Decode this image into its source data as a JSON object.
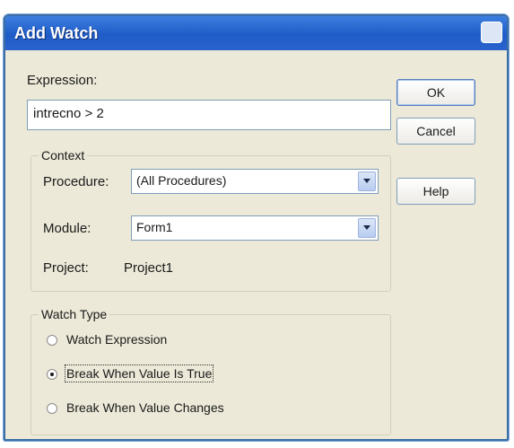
{
  "dialog": {
    "title": "Add Watch",
    "expression_label": "Expression:",
    "expression_value": "intrecno > 2",
    "context": {
      "legend": "Context",
      "procedure_label": "Procedure:",
      "procedure_value": "(All Procedures)",
      "module_label": "Module:",
      "module_value": "Form1",
      "project_label": "Project:",
      "project_value": "Project1"
    },
    "watch_type": {
      "legend": "Watch Type",
      "options": [
        {
          "label": "Watch Expression",
          "selected": false
        },
        {
          "label": "Break When Value Is True",
          "selected": true
        },
        {
          "label": "Break When Value Changes",
          "selected": false
        }
      ]
    },
    "buttons": {
      "ok": "OK",
      "cancel": "Cancel",
      "help": "Help"
    }
  },
  "colors": {
    "titlebar": "#1f5cc7",
    "dialog_bg": "#ece9d8"
  }
}
